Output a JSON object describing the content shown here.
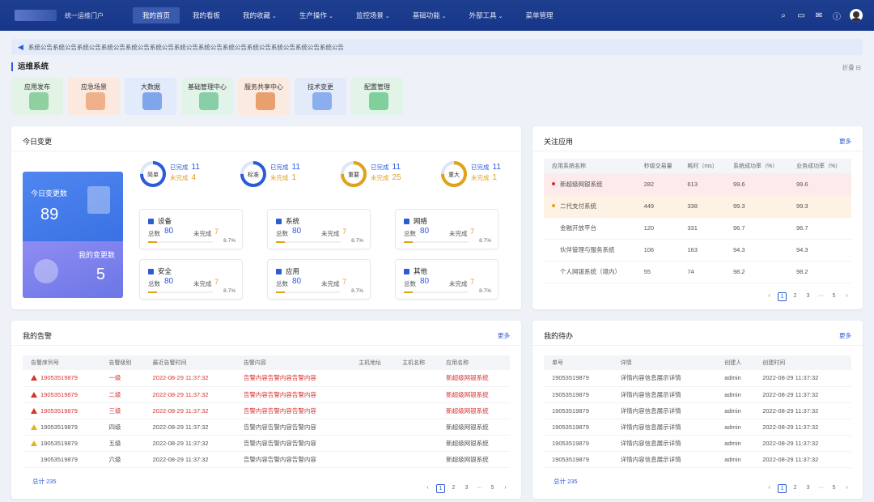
{
  "header": {
    "portal_name": "统一运维门户",
    "nav": [
      {
        "label": "我的首页",
        "active": true,
        "dropdown": false
      },
      {
        "label": "我的看板",
        "active": false,
        "dropdown": false
      },
      {
        "label": "我的收藏",
        "active": false,
        "dropdown": true
      },
      {
        "label": "生产操作",
        "active": false,
        "dropdown": true
      },
      {
        "label": "监控场景",
        "active": false,
        "dropdown": true
      },
      {
        "label": "基础功能",
        "active": false,
        "dropdown": true
      },
      {
        "label": "外部工具",
        "active": false,
        "dropdown": true
      },
      {
        "label": "菜单管理",
        "active": false,
        "dropdown": false
      }
    ],
    "tools": [
      "search-icon",
      "monitor-icon",
      "mail-icon",
      "help-icon"
    ]
  },
  "notice": {
    "text": "系统公告系统公告系统公告系统公告系统公告系统公告系统公告系统公告系统公告系统公告系统公告系统公告系统公告"
  },
  "section": {
    "title": "运维系统",
    "collapse": "折叠"
  },
  "quick_links": [
    {
      "label": "应用发布",
      "color": "#e3f3e6",
      "ill": "#8fd0a0"
    },
    {
      "label": "应急场景",
      "color": "#fbe9df",
      "ill": "#f0b08c"
    },
    {
      "label": "大数据",
      "color": "#e1ebfb",
      "ill": "#7fa6ea"
    },
    {
      "label": "基础管理中心",
      "color": "#e2f3ea",
      "ill": "#88cfa7"
    },
    {
      "label": "服务共享中心",
      "color": "#fbeadf",
      "ill": "#e8a06f"
    },
    {
      "label": "技术变更",
      "color": "#e3ebfb",
      "ill": "#8aaeee"
    },
    {
      "label": "配置管理",
      "color": "#e2f3e8",
      "ill": "#7fd09a"
    }
  ],
  "today": {
    "title": "今日变更",
    "today_label": "今日变更数",
    "today_value": "89",
    "mine_label": "我的变更数",
    "mine_value": "5",
    "rings": [
      {
        "name": "简单",
        "done_label": "已完成",
        "done": "11",
        "todo_label": "未完成",
        "todo": "4",
        "color": "#2c5bd6"
      },
      {
        "name": "标准",
        "done_label": "已完成",
        "done": "11",
        "todo_label": "未完成",
        "todo": "1",
        "color": "#2c5bd6"
      },
      {
        "name": "重要",
        "done_label": "已完成",
        "done": "11",
        "todo_label": "未完成",
        "todo": "25",
        "color": "#e0a21b"
      },
      {
        "name": "重大",
        "done_label": "已完成",
        "done": "11",
        "todo_label": "未完成",
        "todo": "1",
        "color": "#e0a21b"
      }
    ],
    "categories": [
      {
        "name": "设备",
        "total_label": "总数",
        "total": "80",
        "todo_label": "未完成",
        "todo": "7",
        "pct": "8.7%",
        "fill": 0.087
      },
      {
        "name": "系统",
        "total_label": "总数",
        "total": "80",
        "todo_label": "未完成",
        "todo": "7",
        "pct": "8.7%",
        "fill": 0.087
      },
      {
        "name": "网络",
        "total_label": "总数",
        "total": "80",
        "todo_label": "未完成",
        "todo": "7",
        "pct": "8.7%",
        "fill": 0.087
      },
      {
        "name": "安全",
        "total_label": "总数",
        "total": "80",
        "todo_label": "未完成",
        "todo": "7",
        "pct": "8.7%",
        "fill": 0.087
      },
      {
        "name": "应用",
        "total_label": "总数",
        "total": "80",
        "todo_label": "未完成",
        "todo": "7",
        "pct": "8.7%",
        "fill": 0.087
      },
      {
        "name": "其他",
        "total_label": "总数",
        "total": "80",
        "todo_label": "未完成",
        "todo": "7",
        "pct": "8.7%",
        "fill": 0.087
      }
    ]
  },
  "focus": {
    "title": "关注应用",
    "more": "更多",
    "columns": [
      "应用系统名称",
      "秒级交易量",
      "耗时（ms）",
      "系统成功率（%）",
      "业务成功率（%）"
    ],
    "rows": [
      [
        "新超级网银系统",
        "282",
        "613",
        "99.6",
        "99.6"
      ],
      [
        "二代支付系统",
        "449",
        "338",
        "99.3",
        "99.3"
      ],
      [
        "金融开放平台",
        "120",
        "331",
        "96.7",
        "96.7"
      ],
      [
        "伙伴管理与服务系统",
        "106",
        "163",
        "94.3",
        "94.3"
      ],
      [
        "个人网银系统（境内）",
        "55",
        "74",
        "98.2",
        "98.2"
      ]
    ],
    "pager": {
      "prev": "‹",
      "pages": [
        "1",
        "2",
        "3"
      ],
      "ellipsis": "···",
      "last": "5",
      "next": "›"
    }
  },
  "alerts": {
    "title": "我的告警",
    "more": "更多",
    "columns": [
      "告警序列号",
      "告警级别",
      "最近告警时间",
      "告警内容",
      "主机地址",
      "主机名称",
      "应用名称"
    ],
    "rows": [
      [
        "19053519879",
        "一级",
        "2022-08-29 11:37:32",
        "告警内容告警内容告警内容",
        "",
        "",
        "新超级网银系统"
      ],
      [
        "19053519879",
        "二级",
        "2022-08-29 11:37:32",
        "告警内容告警内容告警内容",
        "",
        "",
        "新超级网银系统"
      ],
      [
        "19053519879",
        "三级",
        "2022-08-29 11:37:32",
        "告警内容告警内容告警内容",
        "",
        "",
        "新超级网银系统"
      ],
      [
        "19053519879",
        "四级",
        "2022-08-29 11:37:32",
        "告警内容告警内容告警内容",
        "",
        "",
        "新超级网银系统"
      ],
      [
        "19053519879",
        "五级",
        "2022-08-29 11:37:32",
        "告警内容告警内容告警内容",
        "",
        "",
        "新超级网银系统"
      ],
      [
        "19053519879",
        "六级",
        "2022-08-29 11:37:32",
        "告警内容告警内容告警内容",
        "",
        "",
        "新超级网银系统"
      ]
    ],
    "total": "总计 235",
    "pager": {
      "prev": "‹",
      "pages": [
        "1",
        "2",
        "3"
      ],
      "ellipsis": "···",
      "last": "5",
      "next": "›"
    }
  },
  "todo": {
    "title": "我的待办",
    "more": "更多",
    "columns": [
      "单号",
      "详情",
      "创建人",
      "创建时间"
    ],
    "rows": [
      [
        "19053519879",
        "详情内容信息展示详情",
        "admin",
        "2022-08-29 11:37:32"
      ],
      [
        "19053519879",
        "详情内容信息展示详情",
        "admin",
        "2022-08-29 11:37:32"
      ],
      [
        "19053519879",
        "详情内容信息展示详情",
        "admin",
        "2022-08-29 11:37:32"
      ],
      [
        "19053519879",
        "详情内容信息展示详情",
        "admin",
        "2022-08-29 11:37:32"
      ],
      [
        "19053519879",
        "详情内容信息展示详情",
        "admin",
        "2022-08-29 11:37:32"
      ],
      [
        "19053519879",
        "详情内容信息展示详情",
        "admin",
        "2022-08-29 11:37:32"
      ]
    ],
    "total": "总计 235",
    "pager": {
      "prev": "‹",
      "pages": [
        "1",
        "2",
        "3"
      ],
      "ellipsis": "···",
      "last": "5",
      "next": "›"
    }
  }
}
